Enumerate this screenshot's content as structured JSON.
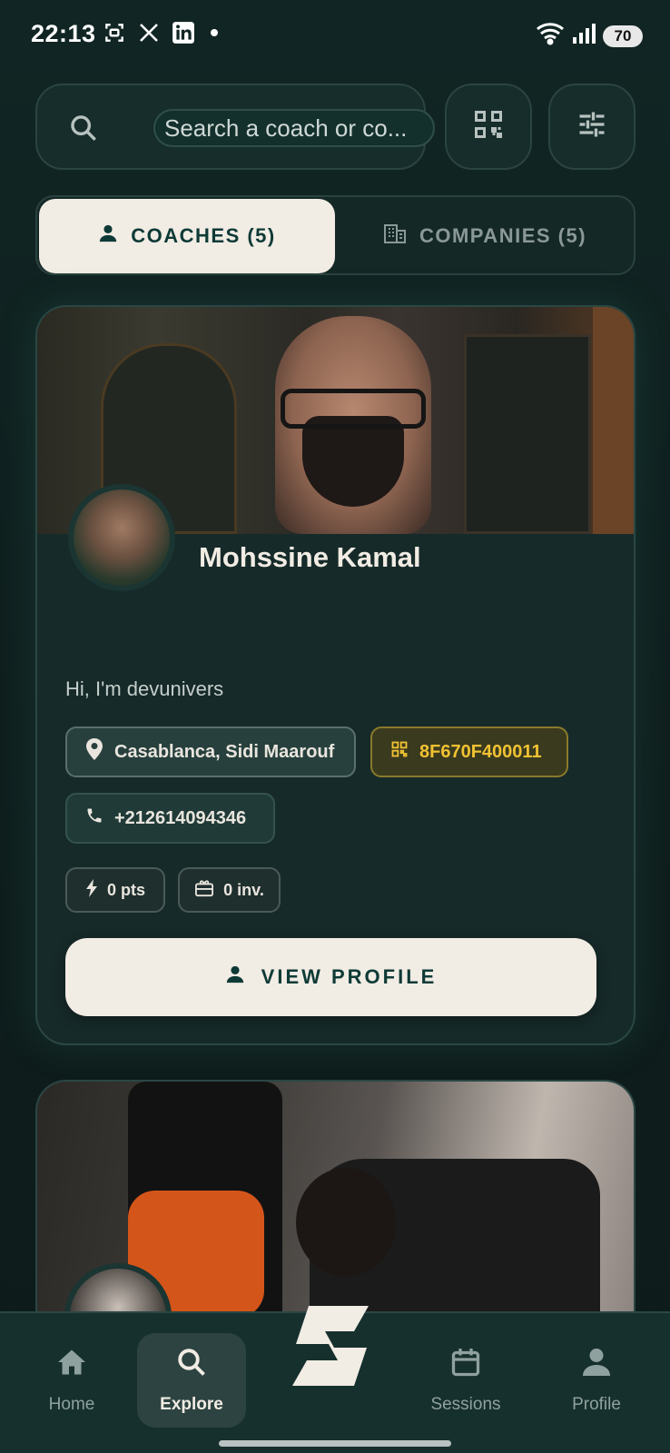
{
  "status_bar": {
    "time": "22:13",
    "battery": "70"
  },
  "search": {
    "placeholder": "Search a coach or co..."
  },
  "tabs": [
    {
      "label": "COACHES (5)",
      "active": true
    },
    {
      "label": "COMPANIES (5)",
      "active": false
    }
  ],
  "coach_card": {
    "name": "Mohssine Kamal",
    "bio": "Hi, I'm devunivers",
    "location": "Casablanca, Sidi Maarouf",
    "code": "8F670F400011",
    "phone": "+212614094346",
    "points": "0 pts",
    "invites": "0 inv.",
    "view_profile_label": "VIEW PROFILE"
  },
  "bottom_nav": {
    "items": [
      {
        "label": "Home",
        "icon": "home-icon"
      },
      {
        "label": "Explore",
        "icon": "search-icon",
        "active": true
      },
      {
        "label": "Sessions",
        "icon": "calendar-icon"
      },
      {
        "label": "Profile",
        "icon": "person-icon"
      }
    ]
  },
  "colors": {
    "background": "#0f201f",
    "card": "#162a29",
    "accent_cream": "#f1ece4",
    "accent_dark_teal": "#0e3a36",
    "code_yellow": "#f1c232"
  }
}
